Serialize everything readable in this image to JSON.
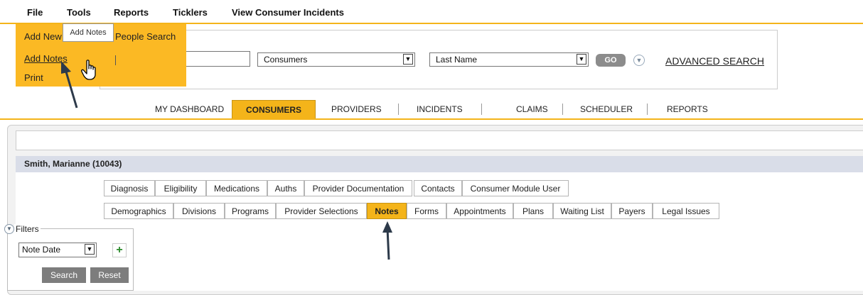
{
  "menubar": {
    "items": [
      "File",
      "Tools",
      "Reports",
      "Ticklers",
      "View Consumer Incidents"
    ]
  },
  "file_menu": {
    "add_new": "Add New",
    "people_search": "People Search",
    "add_notes": "Add Notes",
    "print": "Print"
  },
  "tooltip": "Add Notes",
  "search": {
    "text_value": "",
    "module_select": "Consumers",
    "field_select": "Last Name",
    "go_label": "GO",
    "advanced_label": "ADVANCED SEARCH"
  },
  "main_nav": {
    "items": [
      "MY DASHBOARD",
      "CONSUMERS",
      "PROVIDERS",
      "INCIDENTS",
      "CLAIMS",
      "SCHEDULER",
      "REPORTS"
    ],
    "active": "CONSUMERS"
  },
  "person": {
    "title": "Smith, Marianne (10043)"
  },
  "tabs_row1": [
    "Diagnosis",
    "Eligibility",
    "Medications",
    "Auths",
    "Provider Documentation",
    "Contacts",
    "Consumer Module User"
  ],
  "tabs_row2": [
    "Demographics",
    "Divisions",
    "Programs",
    "Provider Selections",
    "Notes",
    "Forms",
    "Appointments",
    "Plans",
    "Waiting List",
    "Payers",
    "Legal Issues"
  ],
  "active_tab": "Notes",
  "filters": {
    "label": "Filters",
    "select_value": "Note Date",
    "search_label": "Search",
    "reset_label": "Reset"
  },
  "colors": {
    "accent": "#F4B41A",
    "dropdown_bg": "#FBB924",
    "person_bar": "#D9DDE8",
    "button_gray": "#7D7D7D"
  }
}
